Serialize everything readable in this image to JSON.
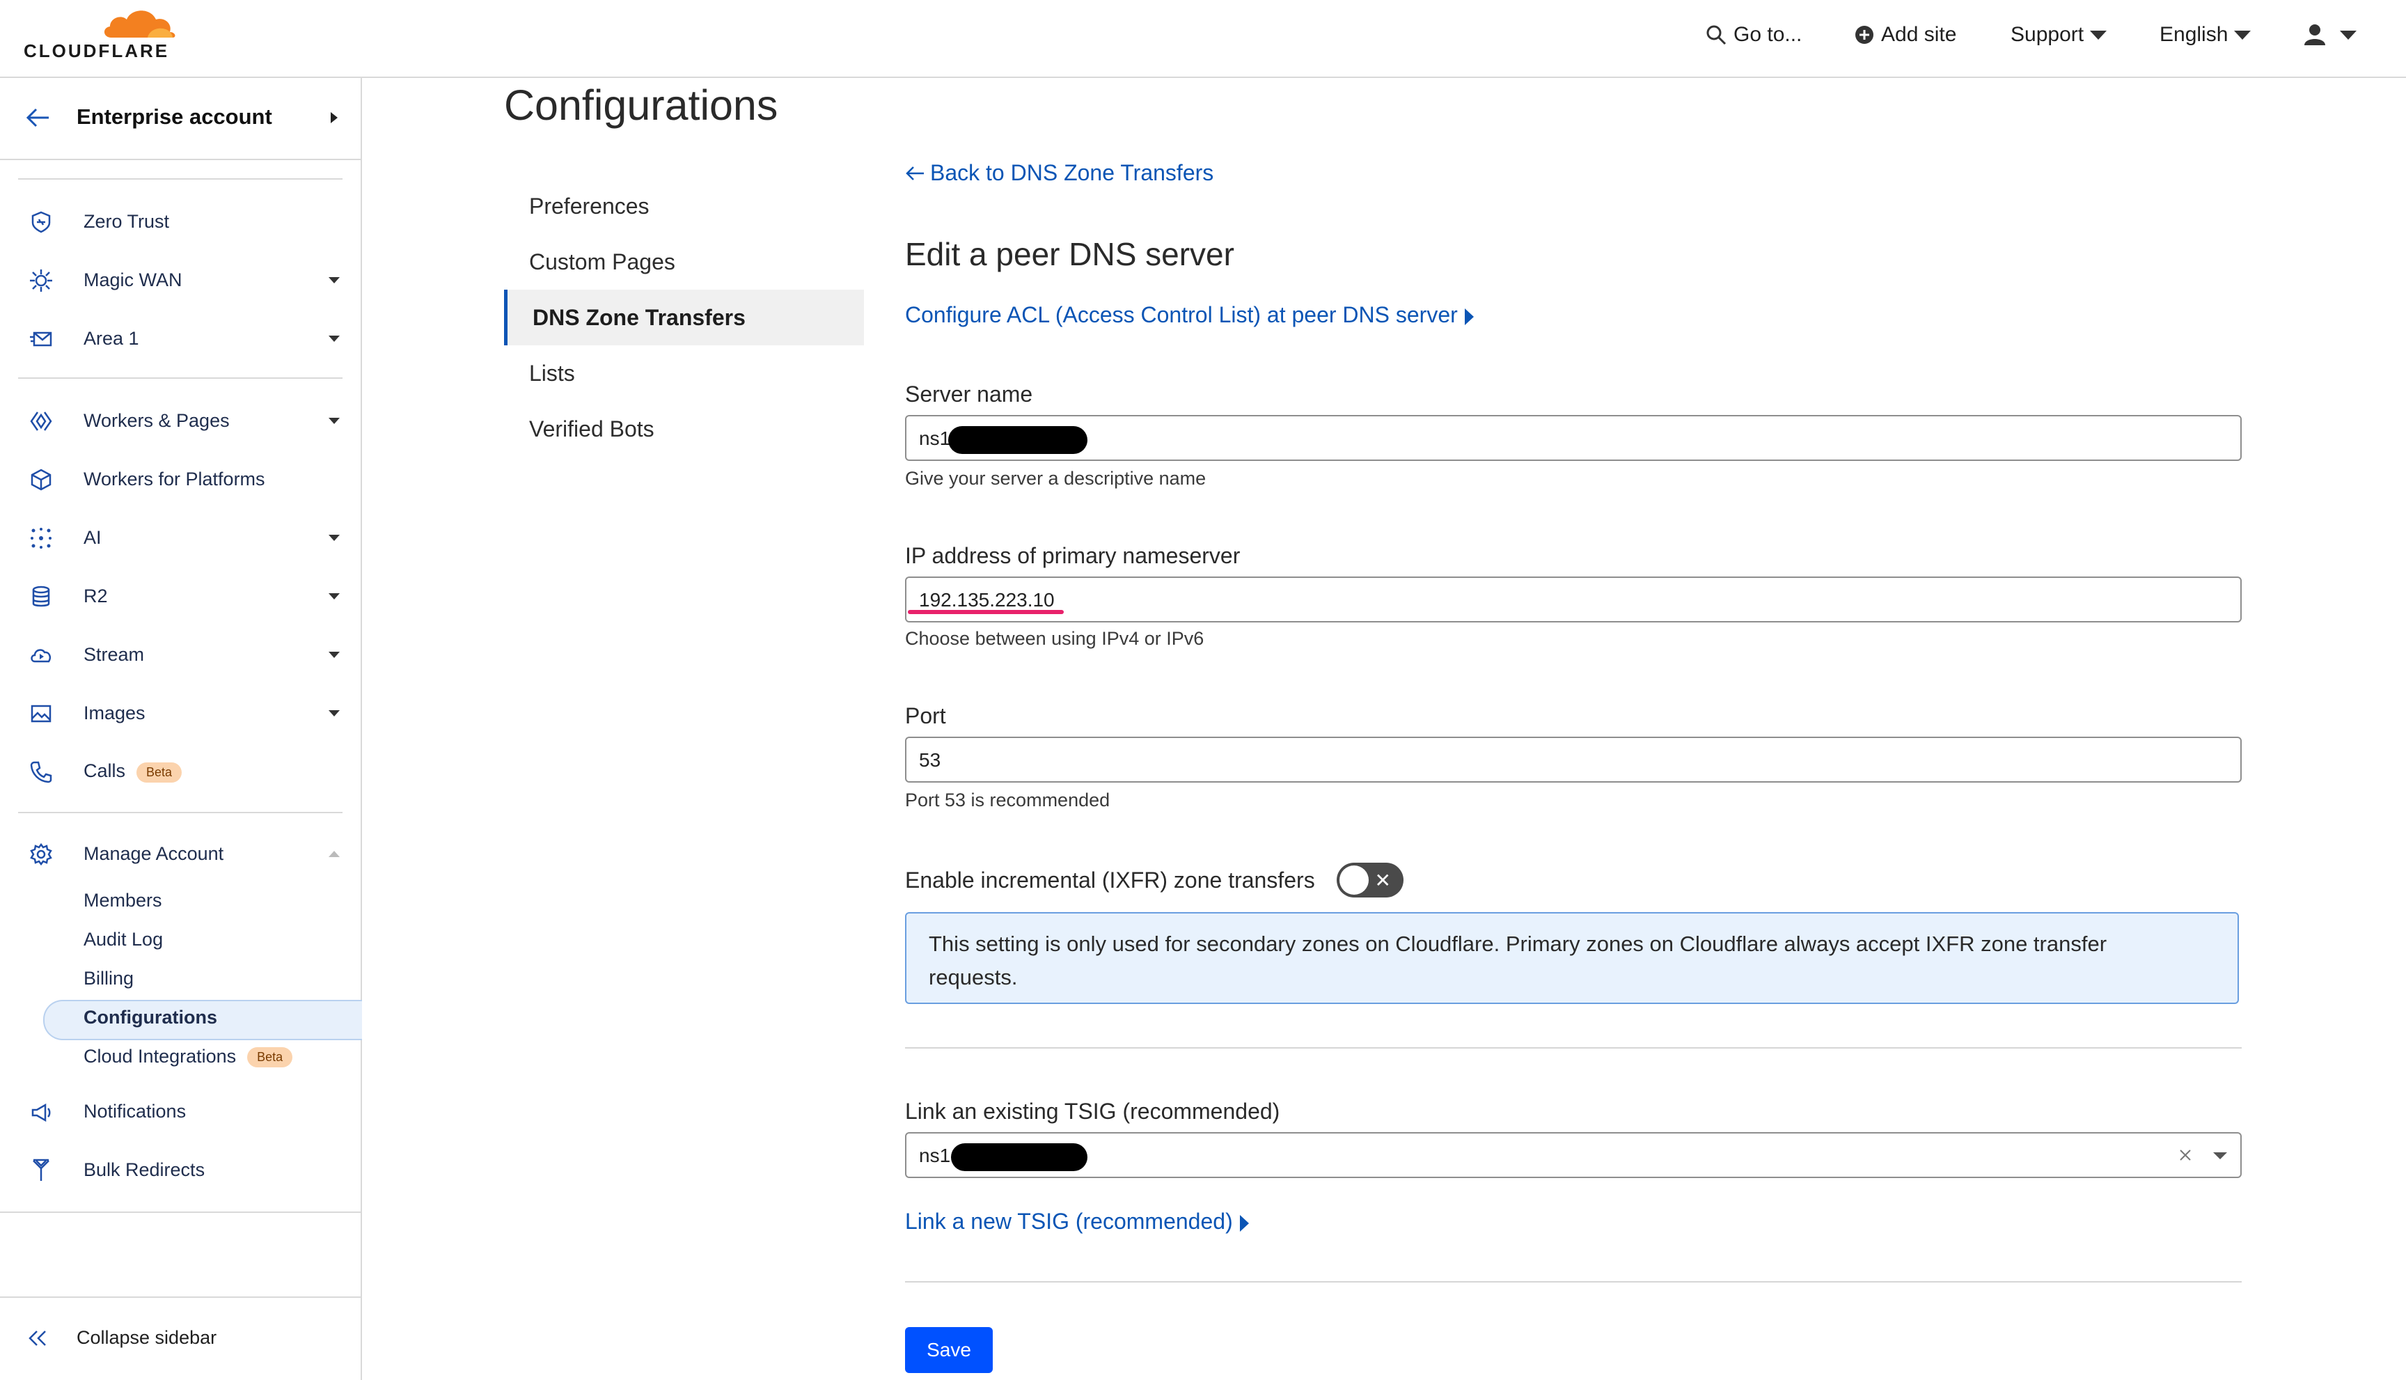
{
  "header": {
    "logo_text": "CLOUDFLARE",
    "goto_label": "Go to...",
    "add_site_label": "Add site",
    "support_label": "Support",
    "language_label": "English",
    "icons": {
      "goto": "search-icon",
      "add_site": "plus-circle-icon",
      "user": "user-icon"
    }
  },
  "sidebar": {
    "account": "Enterprise account",
    "items": [
      {
        "label": "Zero Trust",
        "icon": "zero-trust-icon"
      },
      {
        "label": "Magic WAN",
        "icon": "magic-wan-icon"
      },
      {
        "label": "Area 1",
        "icon": "mail-icon"
      },
      {
        "label": "Workers & Pages",
        "icon": "workers-icon"
      },
      {
        "label": "Workers for Platforms",
        "icon": "cube-icon"
      },
      {
        "label": "AI",
        "icon": "sparkle-icon"
      },
      {
        "label": "R2",
        "icon": "database-icon"
      },
      {
        "label": "Stream",
        "icon": "cloud-play-icon"
      },
      {
        "label": "Images",
        "icon": "image-icon"
      },
      {
        "label": "Calls",
        "icon": "phone-icon",
        "badge": "Beta"
      },
      {
        "label": "Manage Account",
        "icon": "gear-icon"
      },
      {
        "label": "Notifications",
        "icon": "megaphone-icon"
      },
      {
        "label": "Bulk Redirects",
        "icon": "redirect-icon"
      }
    ],
    "manage_sub": [
      {
        "label": "Members"
      },
      {
        "label": "Audit Log"
      },
      {
        "label": "Billing"
      },
      {
        "label": "Configurations",
        "active": true
      },
      {
        "label": "Cloud Integrations",
        "badge": "Beta"
      }
    ],
    "collapse_label": "Collapse sidebar"
  },
  "main": {
    "title": "Configurations",
    "subnav": [
      {
        "label": "Preferences"
      },
      {
        "label": "Custom Pages"
      },
      {
        "label": "DNS Zone Transfers",
        "active": true
      },
      {
        "label": "Lists"
      },
      {
        "label": "Verified Bots"
      }
    ],
    "back_link": "Back to DNS Zone Transfers",
    "heading": "Edit a peer DNS server",
    "acl_link": "Configure ACL (Access Control List) at peer DNS server",
    "server_name": {
      "label": "Server name",
      "value": "ns1",
      "help": "Give your server a descriptive name"
    },
    "ip": {
      "label": "IP address of primary nameserver",
      "value": "192.135.223.10",
      "help": "Choose between using IPv4 or IPv6"
    },
    "port": {
      "label": "Port",
      "value": "53",
      "help": "Port 53 is recommended"
    },
    "ixfr": {
      "label": "Enable incremental (IXFR) zone transfers",
      "enabled": false
    },
    "info_text": "This setting is only used for secondary zones on Cloudflare. Primary zones on Cloudflare always accept IXFR zone transfer requests.",
    "tsig": {
      "label": "Link an existing TSIG (recommended)",
      "value": "ns1"
    },
    "new_tsig_link": "Link a new TSIG (recommended)",
    "save_label": "Save"
  },
  "colors": {
    "accent": "#0b55b5",
    "save_button": "#0051ff",
    "logo_orange": "#f38020",
    "highlight": "#e8216b"
  }
}
